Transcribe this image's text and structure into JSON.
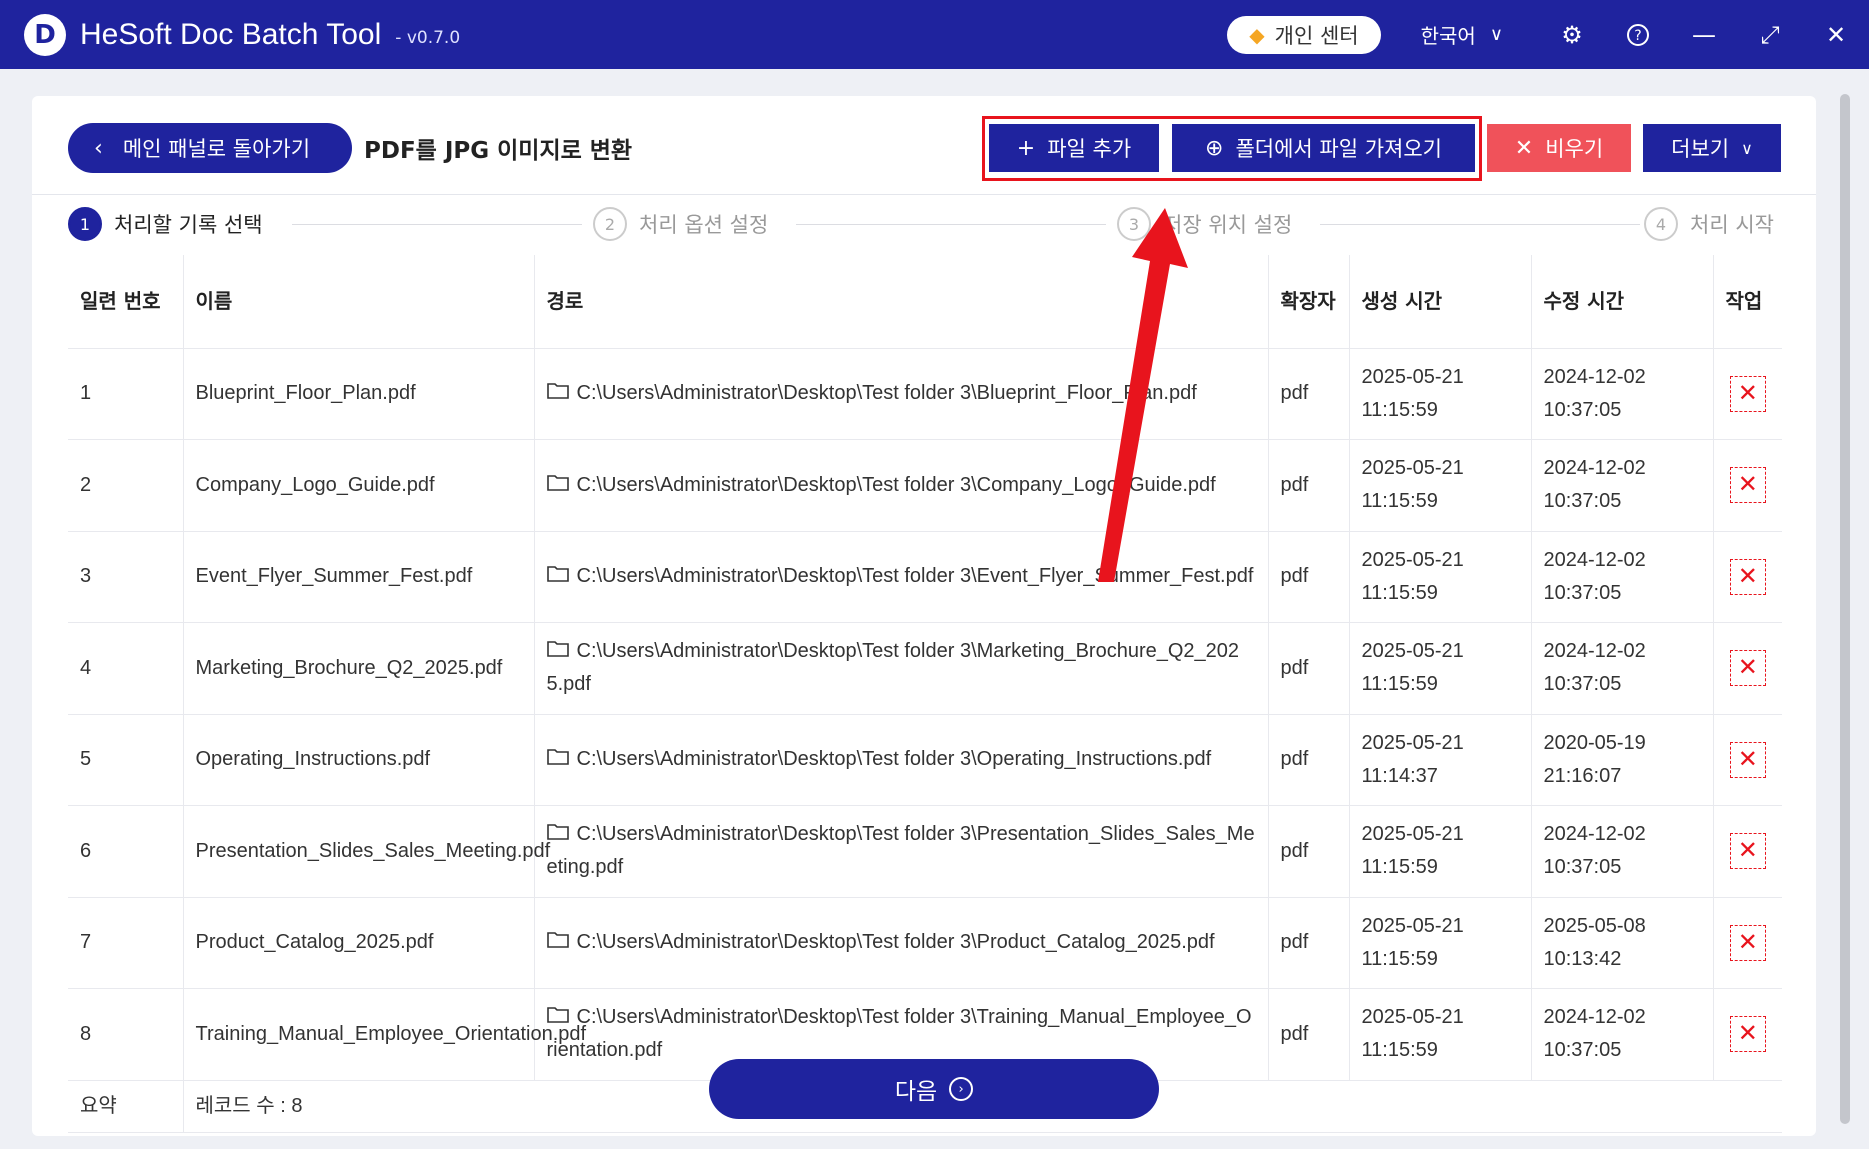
{
  "app": {
    "logo_letter": "D",
    "title": "HeSoft Doc Batch Tool",
    "version": "- v0.7.0",
    "user_center": "개인 센터",
    "language": "한국어"
  },
  "header": {
    "back_label": "메인 패널로 돌아가기",
    "page_title": "PDF를 JPG 이미지로 변환",
    "add_file": "파일 추가",
    "import_folder": "폴더에서 파일 가져오기",
    "clear": "비우기",
    "more": "더보기"
  },
  "steps": [
    {
      "num": "1",
      "label": "처리할 기록 선택"
    },
    {
      "num": "2",
      "label": "처리 옵션 설정"
    },
    {
      "num": "3",
      "label": "저장 위치 설정"
    },
    {
      "num": "4",
      "label": "처리 시작"
    }
  ],
  "table": {
    "headers": [
      "일련 번호",
      "이름",
      "경로",
      "확장자",
      "생성 시간",
      "수정 시간",
      "작업"
    ],
    "rows": [
      {
        "no": "1",
        "name": "Blueprint_Floor_Plan.pdf",
        "path": "C:\\Users\\Administrator\\Desktop\\Test folder 3\\Blueprint_Floor_Plan.pdf",
        "ext": "pdf",
        "created": "2025-05-21 11:15:59",
        "modified": "2024-12-02 10:37:05"
      },
      {
        "no": "2",
        "name": "Company_Logo_Guide.pdf",
        "path": "C:\\Users\\Administrator\\Desktop\\Test folder 3\\Company_Logo_Guide.pdf",
        "ext": "pdf",
        "created": "2025-05-21 11:15:59",
        "modified": "2024-12-02 10:37:05"
      },
      {
        "no": "3",
        "name": "Event_Flyer_Summer_Fest.pdf",
        "path": "C:\\Users\\Administrator\\Desktop\\Test folder 3\\Event_Flyer_Summer_Fest.pdf",
        "ext": "pdf",
        "created": "2025-05-21 11:15:59",
        "modified": "2024-12-02 10:37:05"
      },
      {
        "no": "4",
        "name": "Marketing_Brochure_Q2_2025.pdf",
        "path": "C:\\Users\\Administrator\\Desktop\\Test folder 3\\Marketing_Brochure_Q2_2025.pdf",
        "ext": "pdf",
        "created": "2025-05-21 11:15:59",
        "modified": "2024-12-02 10:37:05"
      },
      {
        "no": "5",
        "name": "Operating_Instructions.pdf",
        "path": "C:\\Users\\Administrator\\Desktop\\Test folder 3\\Operating_Instructions.pdf",
        "ext": "pdf",
        "created": "2025-05-21 11:14:37",
        "modified": "2020-05-19 21:16:07"
      },
      {
        "no": "6",
        "name": "Presentation_Slides_Sales_Meeting.pdf",
        "path": "C:\\Users\\Administrator\\Desktop\\Test folder 3\\Presentation_Slides_Sales_Meeting.pdf",
        "ext": "pdf",
        "created": "2025-05-21 11:15:59",
        "modified": "2024-12-02 10:37:05"
      },
      {
        "no": "7",
        "name": "Product_Catalog_2025.pdf",
        "path": "C:\\Users\\Administrator\\Desktop\\Test folder 3\\Product_Catalog_2025.pdf",
        "ext": "pdf",
        "created": "2025-05-21 11:15:59",
        "modified": "2025-05-08 10:13:42"
      },
      {
        "no": "8",
        "name": "Training_Manual_Employee_Orientation.pdf",
        "path": "C:\\Users\\Administrator\\Desktop\\Test folder 3\\Training_Manual_Employee_Orientation.pdf",
        "ext": "pdf",
        "created": "2025-05-21 11:15:59",
        "modified": "2024-12-02 10:37:05"
      }
    ],
    "summary_label": "요약",
    "summary_value": "레코드 수 : 8"
  },
  "next_label": "다음",
  "icons": {
    "gem": "diamond-icon",
    "settings": "gear-icon",
    "help": "question-icon",
    "minimize": "minimize-icon",
    "maximize": "expand-icon",
    "close": "close-icon",
    "folder": "folder-icon",
    "delete": "close-icon"
  },
  "colors": {
    "brand": "#1f239e",
    "danger": "#f0525a",
    "highlight": "#e8141d"
  }
}
